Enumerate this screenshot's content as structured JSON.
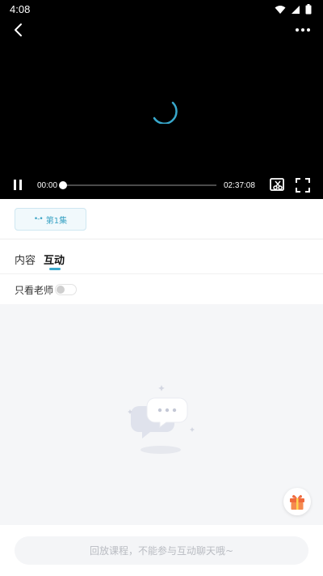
{
  "status_bar": {
    "time": "4:08"
  },
  "player": {
    "current_time": "00:00",
    "total_time": "02:37:08",
    "progress": 0.0
  },
  "episode": {
    "label": "第1集"
  },
  "tabs": [
    {
      "label": "内容",
      "active": false
    },
    {
      "label": "互动",
      "active": true
    }
  ],
  "filter": {
    "label": "只看老师",
    "enabled": false
  },
  "input": {
    "placeholder": "回放课程，不能参与互动聊天哦~"
  },
  "colors": {
    "accent": "#38a8cc",
    "video_bg": "#000000",
    "chat_bg": "#f5f6f8"
  }
}
